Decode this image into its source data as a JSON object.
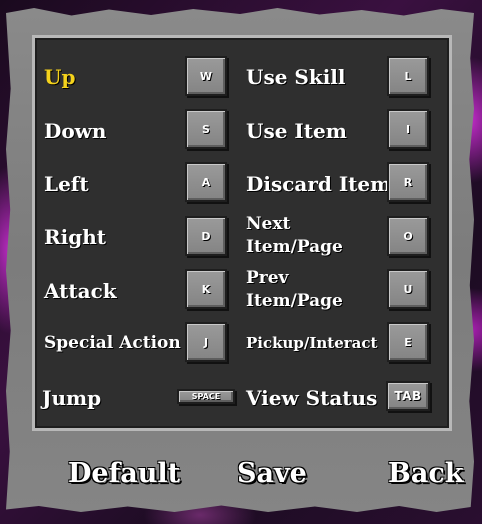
{
  "colors": {
    "selected": "#f4d21c",
    "panel": "#2f2f2f",
    "frame": "#808080",
    "backdrop_accent": "#c02bc8"
  },
  "bindings": {
    "left": [
      {
        "label": "Up",
        "key": "W"
      },
      {
        "label": "Down",
        "key": "S"
      },
      {
        "label": "Left",
        "key": "A"
      },
      {
        "label": "Right",
        "key": "D"
      },
      {
        "label": "Attack",
        "key": "K"
      },
      {
        "label": "Special Action",
        "key": "J"
      },
      {
        "label": "Jump",
        "key": "SPACE"
      }
    ],
    "right": [
      {
        "label": "Use Skill",
        "key": "L"
      },
      {
        "label": "Use Item",
        "key": "I"
      },
      {
        "label": "Discard Item",
        "key": "R"
      },
      {
        "label": "Next Item/Page",
        "label_lines": [
          "Next",
          "Item/Page"
        ],
        "key": "O"
      },
      {
        "label": "Prev Item/Page",
        "label_lines": [
          "Prev",
          "Item/Page"
        ],
        "key": "U"
      },
      {
        "label": "Pickup/Interact",
        "key": "E"
      },
      {
        "label": "View Status",
        "key": "TAB"
      }
    ],
    "selected": "Up"
  },
  "footer": {
    "default_label": "Default",
    "save_label": "Save",
    "back_label": "Back"
  }
}
